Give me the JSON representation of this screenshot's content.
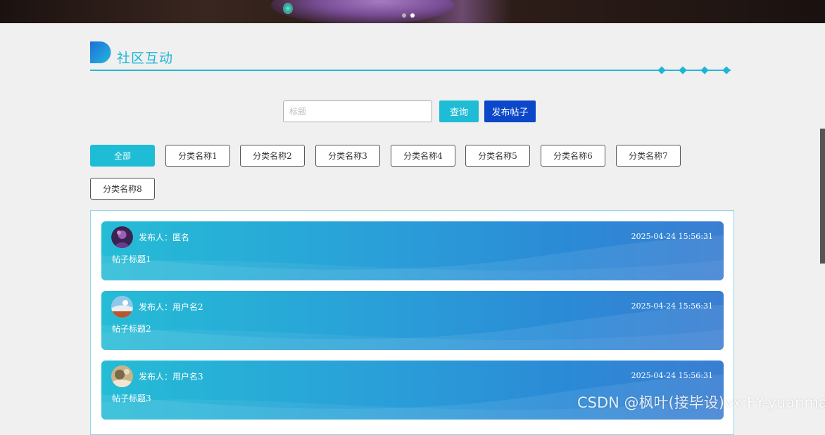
{
  "section": {
    "title": "社区互动"
  },
  "search": {
    "placeholder": "标题",
    "value": "",
    "query_label": "查询",
    "publish_label": "发布帖子"
  },
  "categories": [
    {
      "label": "全部",
      "active": true
    },
    {
      "label": "分类名称1",
      "active": false
    },
    {
      "label": "分类名称2",
      "active": false
    },
    {
      "label": "分类名称3",
      "active": false
    },
    {
      "label": "分类名称4",
      "active": false
    },
    {
      "label": "分类名称5",
      "active": false
    },
    {
      "label": "分类名称6",
      "active": false
    },
    {
      "label": "分类名称7",
      "active": false
    },
    {
      "label": "分类名称8",
      "active": false
    }
  ],
  "posts": [
    {
      "publisher_label": "发布人：",
      "publisher": "匿名",
      "time": "2025-04-24 15:56:31",
      "title": "帖子标题1"
    },
    {
      "publisher_label": "发布人：",
      "publisher": "用户名2",
      "time": "2025-04-24 15:56:31",
      "title": "帖子标题2"
    },
    {
      "publisher_label": "发布人：",
      "publisher": "用户名3",
      "time": "2025-04-24 15:56:31",
      "title": "帖子标题3"
    }
  ],
  "watermark": "CSDN @枫叶(接毕设)vx:FY-yuanma",
  "colors": {
    "accent": "#1fbdd5",
    "publish": "#0b47c9",
    "title": "#1cb5d6"
  }
}
